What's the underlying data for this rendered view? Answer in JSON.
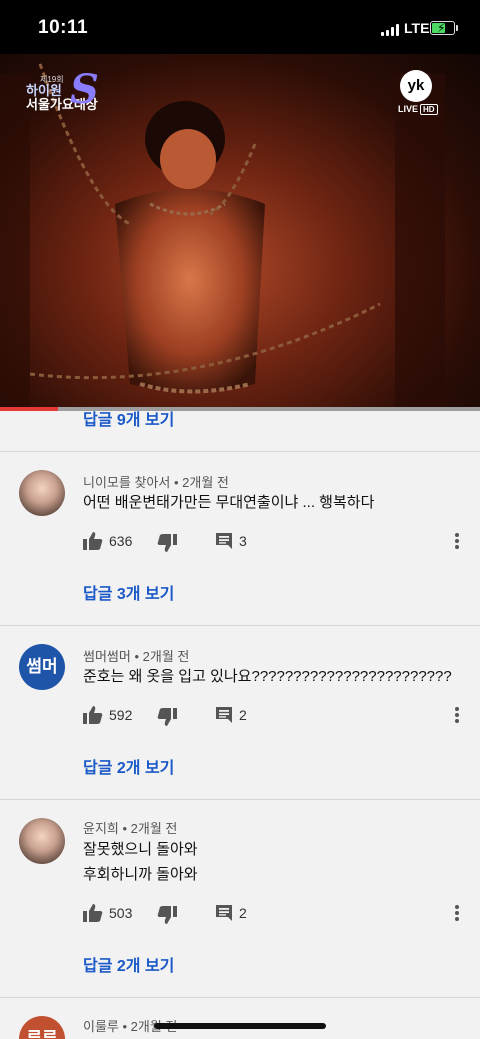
{
  "status_bar": {
    "time": "10:11",
    "network": "LTE"
  },
  "video": {
    "logo_edition": "제19회",
    "logo_line1": "하이원",
    "logo_line2": "서울가요대상",
    "logo_mark": "S",
    "channel_badge": "yk",
    "live_label": "LIVE",
    "hd_label": "HD",
    "progress_percent": 12
  },
  "top_reply_link": "답글 9개 보기",
  "comments": [
    {
      "author": "니이모를 찾아서",
      "time": "2개월 전",
      "text_lines": [
        "어떤 배운변태가만든 무대연출이냐 ... 행복하다"
      ],
      "likes": "636",
      "replies_count": "3",
      "reply_link": "답글 3개 보기",
      "avatar_type": "photo"
    },
    {
      "author": "썸머썸머",
      "time": "2개월 전",
      "text_lines": [
        "준호는 왜 옷을 입고 있나요????????????????????????"
      ],
      "likes": "592",
      "replies_count": "2",
      "reply_link": "답글 2개 보기",
      "avatar_type": "text",
      "avatar_text": "썸머",
      "avatar_color": "#1f55a8"
    },
    {
      "author": "윤지희",
      "time": "2개월 전",
      "text_lines": [
        "잘못했으니 돌아와",
        "후회하니까 돌아와"
      ],
      "likes": "503",
      "replies_count": "2",
      "reply_link": "답글 2개 보기",
      "avatar_type": "photo"
    },
    {
      "author": "이룰루",
      "time": "2개월 전",
      "avatar_type": "text",
      "avatar_text": "루루",
      "avatar_color": "#c0502f"
    }
  ],
  "icons": {
    "like": "thumb-up-icon",
    "dislike": "thumb-down-icon",
    "reply": "comment-icon",
    "more": "more-vert-icon"
  },
  "colors": {
    "link_blue": "#1a59c7",
    "progress_red": "#e53935",
    "background": "#f2f2f2"
  }
}
